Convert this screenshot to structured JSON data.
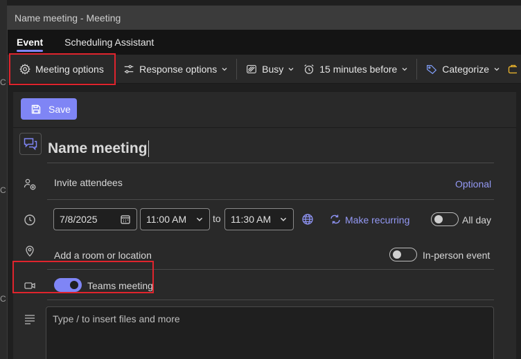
{
  "window": {
    "title": "Name meeting - Meeting"
  },
  "outer_strip": {
    "glyph": "C"
  },
  "tabs": [
    {
      "label": "Event",
      "active": true
    },
    {
      "label": "Scheduling Assistant",
      "active": false
    }
  ],
  "toolbar": {
    "meeting_options": "Meeting options",
    "response_options": "Response options",
    "show_as": "Busy",
    "reminder": "15 minutes before",
    "categorize": "Categorize"
  },
  "form": {
    "save_label": "Save",
    "title_value": "Name meeting",
    "invite_placeholder": "Invite attendees",
    "optional_link": "Optional",
    "date": "7/8/2025",
    "start_time": "11:00 AM",
    "to_label": "to",
    "end_time": "11:30 AM",
    "make_recurring": "Make recurring",
    "all_day_label": "All day",
    "all_day_on": false,
    "location_placeholder": "Add a room or location",
    "in_person_label": "In-person event",
    "in_person_on": false,
    "teams_label": "Teams meeting",
    "teams_on": true,
    "notes_placeholder": "Type / to insert files and more"
  },
  "colors": {
    "accent": "#7f85f5",
    "highlight_box": "#e0242d",
    "background": "#1f1f1f",
    "panel": "#292929"
  }
}
